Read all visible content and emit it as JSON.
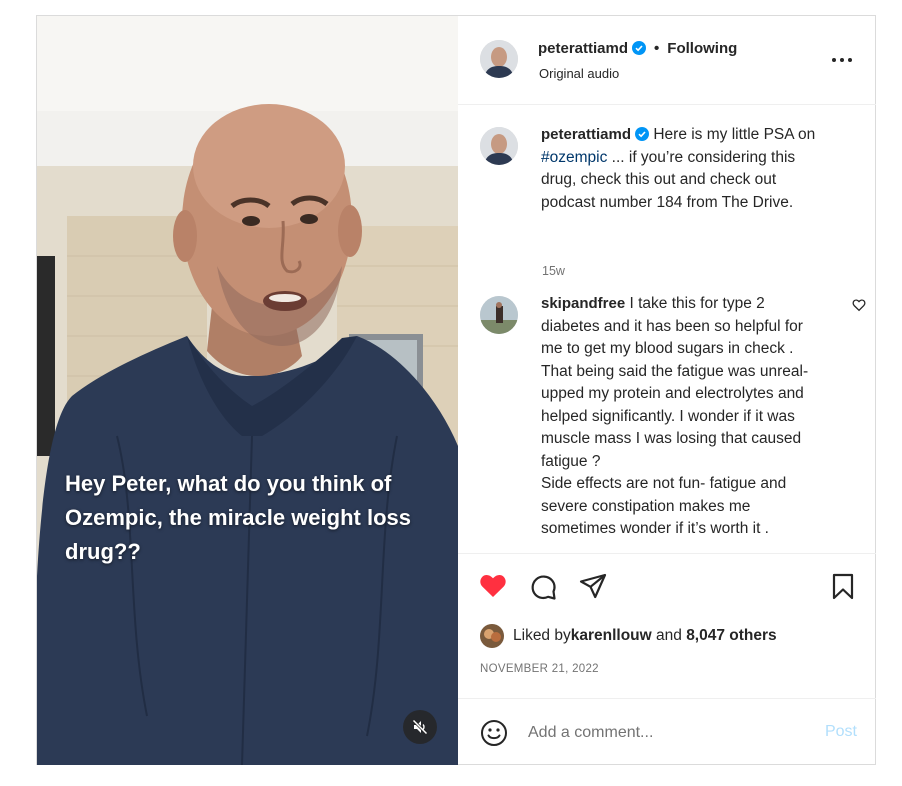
{
  "video": {
    "overlay_text": "Hey Peter, what do you think of Ozempic, the miracle weight loss drug??",
    "mute_icon": "speaker-muted-icon"
  },
  "header": {
    "username": "peterattiamd",
    "separator": "•",
    "follow_status": "Following",
    "audio": "Original audio",
    "more_icon": "more-horizontal-icon"
  },
  "caption": {
    "username": "peterattiamd",
    "text_before": " Here is my little PSA on ",
    "hashtag": "#ozempic",
    "text_after": " ... if you’re considering this drug, check this out and check out podcast number 184 from The Drive.",
    "time": "15w"
  },
  "comment": {
    "username": "skipandfree",
    "text": " I take this for type 2 diabetes and it has been so helpful for me to get my blood sugars in check . That being said the fatigue was unreal- upped my protein and electrolytes and helped significantly. I wonder if it was muscle mass I was losing that caused fatigue ?",
    "text2": "Side effects are not fun- fatigue and severe constipation makes me sometimes wonder if it’s worth it ."
  },
  "actions": {
    "liked_prefix": "Liked by ",
    "liked_user": "karenllouw",
    "and": " and ",
    "others": "8,047 others",
    "date": "NOVEMBER 21, 2022",
    "like_color": "#ff3040"
  },
  "composer": {
    "placeholder": "Add a comment...",
    "post_label": "Post"
  }
}
